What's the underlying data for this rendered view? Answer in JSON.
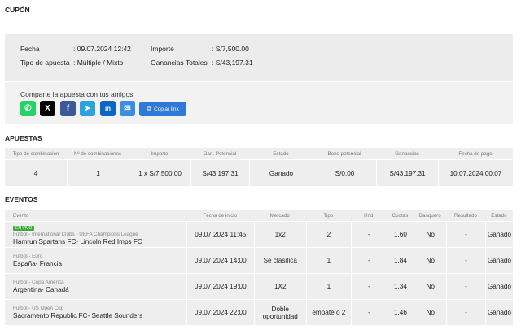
{
  "cupon": {
    "title": "CUPÓN",
    "fecha_label": "Fecha",
    "fecha_value": ": 09.07.2024 12:42",
    "tipo_label": "Tipo de apuesta",
    "tipo_value": ": Múltiple / Mixto",
    "importe_label": "Importe",
    "importe_value": ": S/7,500.00",
    "ganancias_label": "Ganancias Totales",
    "ganancias_value": ": S/43,197.31"
  },
  "share": {
    "label": "Comparte la apuesta con tus amigos",
    "buttons": [
      {
        "icon": "whatsapp-icon",
        "color": "#25d366",
        "glyph": "✆"
      },
      {
        "icon": "x-icon",
        "color": "#000000",
        "glyph": "X"
      },
      {
        "icon": "facebook-icon",
        "color": "#3b5998",
        "glyph": "f"
      },
      {
        "icon": "telegram-icon",
        "color": "#2aa3df",
        "glyph": "➤"
      },
      {
        "icon": "linkedin-icon",
        "color": "#0a66c2",
        "glyph": "in"
      },
      {
        "icon": "email-icon",
        "color": "#3b8fe0",
        "glyph": "✉"
      }
    ],
    "copy_label": "Copiar link"
  },
  "apuestas": {
    "title": "APUESTAS",
    "headers": [
      "Tipo de combinación",
      "Nº de combinaciones",
      "Importe",
      "Gan. Potencial",
      "Estado",
      "Bono potencial",
      "Ganancias",
      "Fecha de pago"
    ],
    "row": [
      "4",
      "1",
      "1 x S/7,500.00",
      "S/43,197.31",
      "Ganado",
      "S/0.00",
      "S/43,197.31",
      "10.07.2024 00:07"
    ]
  },
  "eventos": {
    "title": "EVENTOS",
    "headers": [
      "Evento",
      "Fecha de inicio",
      "Mercado",
      "Tipo",
      "Hnd",
      "Cuotas",
      "Banquero",
      "Resultado",
      "Estado"
    ],
    "live_badge": "EN VIVO",
    "rows": [
      {
        "league": "Fútbol - International Clubs - UEFA Champions League",
        "match": "Hamrun Spartans FC- Lincoln Red Imps FC",
        "fecha": "09.07.2024 11:45",
        "mercado": "1x2",
        "tipo": "2",
        "hnd": "-",
        "cuota": "1.60",
        "banquero": "No",
        "resultado": "-",
        "estado": "Ganado"
      },
      {
        "league": "Fútbol - Euro",
        "match": "España- Francia",
        "fecha": "09.07.2024 14:00",
        "mercado": "Se clasifica",
        "tipo": "1",
        "hnd": "-",
        "cuota": "1.84",
        "banquero": "No",
        "resultado": "-",
        "estado": "Ganado"
      },
      {
        "league": "Fútbol - Copa America",
        "match": "Argentina- Canadá",
        "fecha": "09.07.2024 19:00",
        "mercado": "1X2",
        "tipo": "1",
        "hnd": "-",
        "cuota": "1.34",
        "banquero": "No",
        "resultado": "-",
        "estado": "Ganado"
      },
      {
        "league": "Fútbol - US Open Cup",
        "match": "Sacramento Republic FC- Seattle Sounders",
        "fecha": "09.07.2024 22:00",
        "mercado": "Doble oportunidad",
        "tipo": "empate o 2",
        "hnd": "-",
        "cuota": "1.46",
        "banquero": "No",
        "resultado": "-",
        "estado": "Ganado"
      }
    ]
  }
}
